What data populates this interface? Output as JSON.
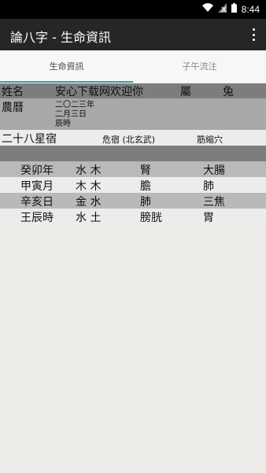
{
  "status": {
    "time": "8:44",
    "wifi_icon": "wifi-icon",
    "signal_icon": "signal-off-icon",
    "battery_icon": "battery-icon"
  },
  "app": {
    "title": "論八字 - 生命資訊"
  },
  "tabs": [
    {
      "label": "生命資訊",
      "active": true
    },
    {
      "label": "子午流注",
      "active": false
    }
  ],
  "info": {
    "name_label": "姓名",
    "name_value": "安心下载网欢迎你",
    "zodiac_label": "屬",
    "zodiac_value": "兔",
    "calendar_label": "農曆",
    "calendar_lines": [
      "二〇二三年",
      "二月三日",
      "辰時"
    ],
    "mansion_label": "二十八星宿",
    "mansion_value": "危宿 (北玄武)",
    "acupoint": "筋縮穴"
  },
  "pillars": [
    {
      "gz": "癸卯年",
      "elements": "水 木",
      "organ1": "腎",
      "organ2": "大腸"
    },
    {
      "gz": "甲寅月",
      "elements": "木 木",
      "organ1": "膽",
      "organ2": "肺"
    },
    {
      "gz": "辛亥日",
      "elements": "金 水",
      "organ1": "肺",
      "organ2": "三焦"
    },
    {
      "gz": "王辰時",
      "elements": "水 土",
      "organ1": "膀胱",
      "organ2": "胃"
    }
  ]
}
